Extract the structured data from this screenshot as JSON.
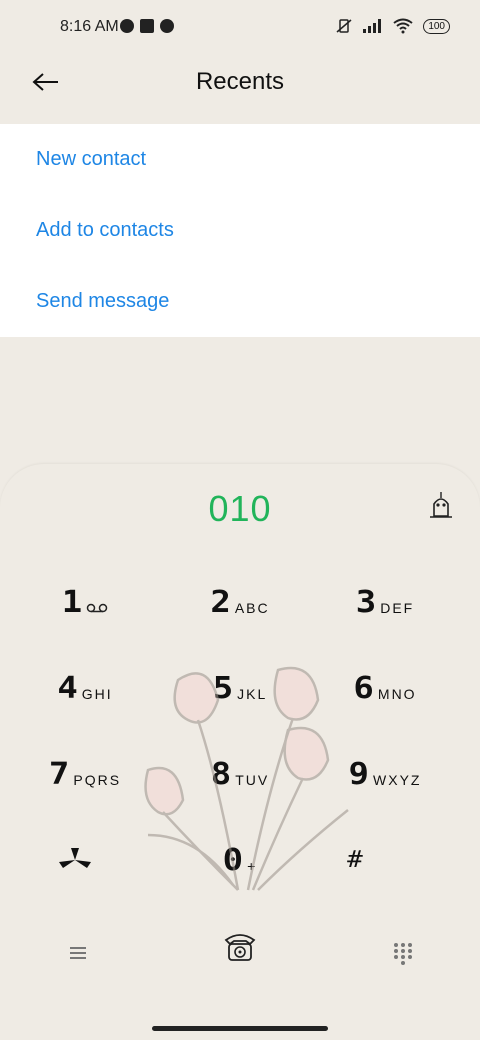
{
  "status": {
    "time": "8:16 AM",
    "battery": "100"
  },
  "header": {
    "title": "Recents"
  },
  "menu": {
    "items": [
      {
        "label": "New contact"
      },
      {
        "label": "Add to contacts"
      },
      {
        "label": "Send message"
      }
    ]
  },
  "dialer": {
    "number": "010",
    "keys": [
      {
        "digit": "1",
        "letters": ""
      },
      {
        "digit": "2",
        "letters": "ABC"
      },
      {
        "digit": "3",
        "letters": "DEF"
      },
      {
        "digit": "4",
        "letters": "GHI"
      },
      {
        "digit": "5",
        "letters": "JKL"
      },
      {
        "digit": "6",
        "letters": "MNO"
      },
      {
        "digit": "7",
        "letters": "PQRS"
      },
      {
        "digit": "8",
        "letters": "TUV"
      },
      {
        "digit": "9",
        "letters": "WXYZ"
      },
      {
        "digit": "",
        "letters": ""
      },
      {
        "digit": "0",
        "letters": "+"
      },
      {
        "digit": "#",
        "letters": ""
      }
    ]
  },
  "colors": {
    "accent_blue": "#1e86e5",
    "number_green": "#21b45a",
    "background": "#efebe4"
  },
  "icons": {
    "back": "arrow-left-icon",
    "voicemail": "voicemail-icon",
    "ghost": "ghost-clean-icon",
    "special_key": "fan-icon",
    "call": "telephone-icon",
    "menu": "hamburger-icon",
    "keypad": "dial-grid-icon"
  }
}
